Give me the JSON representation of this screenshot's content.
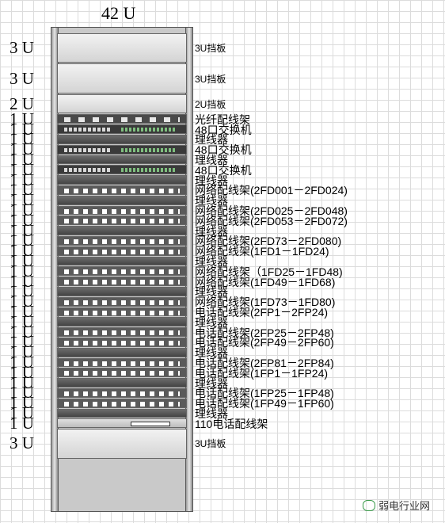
{
  "title": "42 U",
  "rows": [
    {
      "u": "3 U",
      "label": "3U挡板",
      "type": "blank"
    },
    {
      "u": "3 U",
      "label": "3U挡板",
      "type": "blank"
    },
    {
      "u": "2 U",
      "label": "2U挡板",
      "type": "blank"
    },
    {
      "u": "1 U",
      "label": "光纤配线架",
      "type": "fiber"
    },
    {
      "u": "1 U",
      "label": "48口交换机",
      "type": "switch"
    },
    {
      "u": "1 U",
      "label": "理线器",
      "type": "mgr"
    },
    {
      "u": "1 U",
      "label": "48口交换机",
      "type": "switch"
    },
    {
      "u": "1 U",
      "label": "理线器",
      "type": "mgr"
    },
    {
      "u": "1 U",
      "label": "48口交换机",
      "type": "switch"
    },
    {
      "u": "1 U",
      "label": "理线器",
      "type": "mgr"
    },
    {
      "u": "1 U",
      "label": "网络配线架(2FD001－2FD024)",
      "type": "patch"
    },
    {
      "u": "1 U",
      "label": "理线器",
      "type": "mgr"
    },
    {
      "u": "1 U",
      "label": "网络配线架(2FD025－2FD048)",
      "type": "patch"
    },
    {
      "u": "1 U",
      "label": "网络配线架(2FD053－2FD072)",
      "type": "patch"
    },
    {
      "u": "1 U",
      "label": "理线器",
      "type": "mgr"
    },
    {
      "u": "1 U",
      "label": "网络配线架(2FD73－2FD080)",
      "type": "patch"
    },
    {
      "u": "1 U",
      "label": "网络配线架(1FD1－1FD24)",
      "type": "patch"
    },
    {
      "u": "1 U",
      "label": "理线器",
      "type": "mgr"
    },
    {
      "u": "1 U",
      "label": "网络配线架（1FD25－1FD48)",
      "type": "patch"
    },
    {
      "u": "1 U",
      "label": "网络配线架(1FD49－1FD68)",
      "type": "patch"
    },
    {
      "u": "1 U",
      "label": "理线器",
      "type": "mgr"
    },
    {
      "u": "1 U",
      "label": "网络配线架(1FD73－1FD80)",
      "type": "patch"
    },
    {
      "u": "1 U",
      "label": "电话配线架(2FP1－2FP24)",
      "type": "patch"
    },
    {
      "u": "1 U",
      "label": "理线器",
      "type": "mgr"
    },
    {
      "u": "1 U",
      "label": "电话配线架(2FP25－2FP48)",
      "type": "patch"
    },
    {
      "u": "1 U",
      "label": "电话配线架(2FP49－2FP60)",
      "type": "patch"
    },
    {
      "u": "1 U",
      "label": "理线器",
      "type": "mgr"
    },
    {
      "u": "1 U",
      "label": "电话配线架(2FP81－2FP84)",
      "type": "patch"
    },
    {
      "u": "1 U",
      "label": "电话配线架(1FP1－1FP24)",
      "type": "patch"
    },
    {
      "u": "1 U",
      "label": "理线器",
      "type": "mgr"
    },
    {
      "u": "1 U",
      "label": "电话配线架(1FP25－1FP48)",
      "type": "patch"
    },
    {
      "u": "1 U",
      "label": "电话配线架(1FP49－1FP60)",
      "type": "patch"
    },
    {
      "u": "1 U",
      "label": "理线器",
      "type": "mgr"
    },
    {
      "u": "1 U",
      "label": "110电话配线架",
      "type": "p110"
    },
    {
      "u": "3 U",
      "label": "3U挡板",
      "type": "blank"
    }
  ],
  "watermark": "弱电行业网",
  "icons": {
    "watermark": "wechat-icon"
  }
}
